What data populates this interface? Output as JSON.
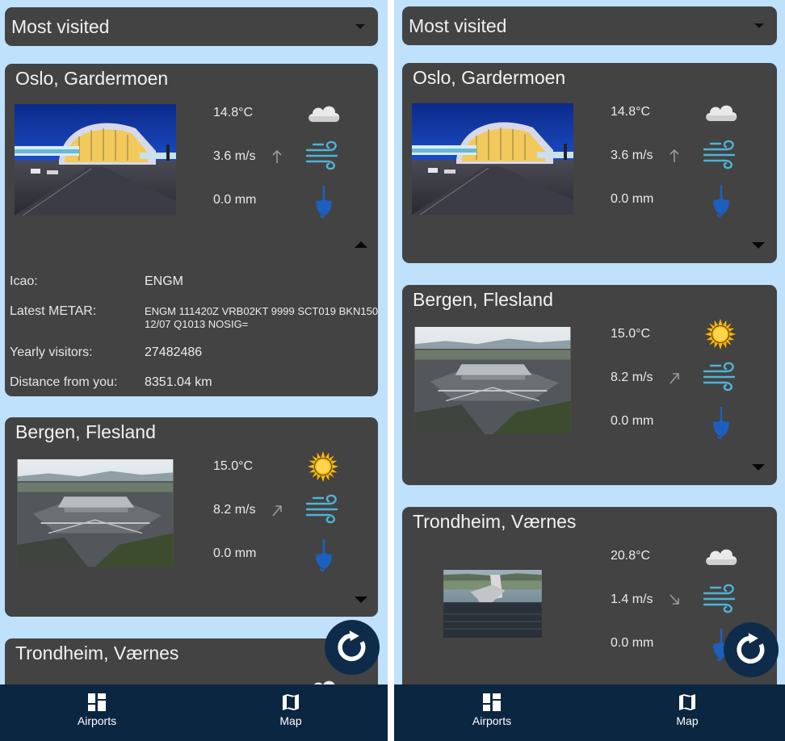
{
  "dropdown": {
    "selected": "Most visited"
  },
  "weather_icons": {
    "cloud": "cloud-icon",
    "sun": "sun-icon",
    "wind": "wind-icon",
    "precipitation": "umbrella-icon"
  },
  "colors": {
    "background": "#bfe1fb",
    "card": "#434343",
    "navbar": "#0b2641",
    "wind_icon": "#4fb3d6",
    "umbrella_icon": "#1d5fbf",
    "sun": "#ffb300"
  },
  "airports": [
    {
      "name": "Oslo, Gardermoen",
      "temperature": "14.8°C",
      "wind": "3.6 m/s",
      "wind_arrow": "up",
      "precipitation": "0.0 mm",
      "weather": "cloud"
    },
    {
      "name": "Bergen, Flesland",
      "temperature": "15.0°C",
      "wind": "8.2 m/s",
      "wind_arrow": "up-right",
      "precipitation": "0.0 mm",
      "weather": "sun"
    },
    {
      "name": "Trondheim, Værnes",
      "temperature": "20.8°C",
      "wind": "1.4 m/s",
      "wind_arrow": "down-right",
      "precipitation": "0.0 mm",
      "weather": "cloud"
    }
  ],
  "details": {
    "icao_label": "Icao:",
    "icao": "ENGM",
    "metar_label": "Latest METAR:",
    "metar": "ENGM 111420Z VRB02KT 9999 SCT019 BKN150 12/07 Q1013 NOSIG=",
    "visitors_label": "Yearly visitors:",
    "visitors": "27482486",
    "distance_label": "Distance from you:",
    "distance": "8351.04 km"
  },
  "fab": {
    "icon": "refresh-icon"
  },
  "nav": [
    {
      "label": "Airports",
      "icon": "dashboard-icon"
    },
    {
      "label": "Map",
      "icon": "map-icon"
    }
  ]
}
